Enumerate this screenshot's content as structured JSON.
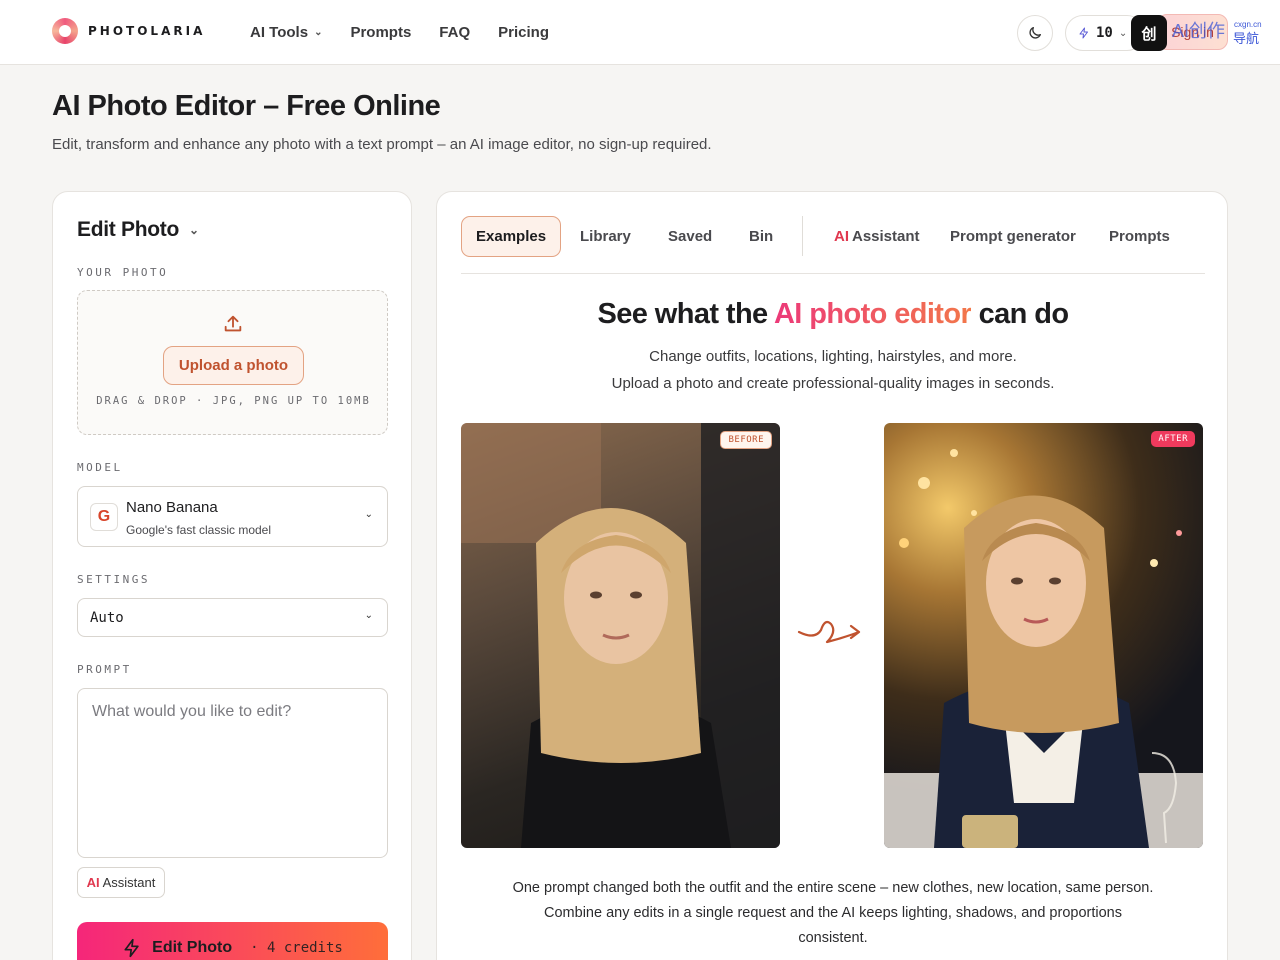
{
  "header": {
    "logo_text": "PHOTOLARIA",
    "nav": [
      {
        "label": "AI Tools",
        "has_dropdown": true
      },
      {
        "label": "Prompts"
      },
      {
        "label": "FAQ"
      },
      {
        "label": "Pricing"
      }
    ],
    "credits": "10",
    "signin_label": "Sign in",
    "overlay": {
      "badge": "创",
      "text": "AI创作",
      "sub": "cxgn.cn",
      "sub2": "导航"
    }
  },
  "page": {
    "title": "AI Photo Editor – Free Online",
    "subtitle": "Edit, transform and enhance any photo with a text prompt – an AI image editor, no sign-up required."
  },
  "editor": {
    "title": "Edit Photo",
    "photo_label": "YOUR PHOTO",
    "upload_button": "Upload a photo",
    "upload_hint": "DRAG & DROP · JPG, PNG UP TO 10MB",
    "model_label": "MODEL",
    "model_name": "Nano Banana",
    "model_desc": "Google's fast classic model",
    "model_logo": "G",
    "settings_label": "SETTINGS",
    "settings_value": "Auto",
    "prompt_label": "PROMPT",
    "prompt_placeholder": "What would you like to edit?",
    "assistant_ai": "AI",
    "assistant_label": "Assistant",
    "edit_button": "Edit Photo",
    "edit_credits": "· 4 credits"
  },
  "showcase": {
    "tabs": [
      {
        "label": "Examples",
        "active": true
      },
      {
        "label": "Library"
      },
      {
        "label": "Saved"
      },
      {
        "label": "Bin"
      },
      {
        "ai": "AI",
        "label": "Assistant"
      },
      {
        "label": "Prompt generator"
      },
      {
        "label": "Prompts"
      }
    ],
    "title_pre": "See what the ",
    "title_highlight": "AI photo editor",
    "title_post": " can do",
    "sub_line1": "Change outfits, locations, lighting, hairstyles, and more.",
    "sub_line2": "Upload a photo and create professional-quality images in seconds.",
    "before_tag": "BEFORE",
    "after_tag": "AFTER",
    "caption_line1": "One prompt changed both the outfit and the entire scene – new clothes, new location, same person.",
    "caption_line2": "Combine any edits in a single request and the AI keeps lighting, shadows, and proportions",
    "caption_line3": "consistent."
  },
  "colors": {
    "accent_orange": "#c0532f",
    "gradient_start": "#f5267a",
    "gradient_end": "#ff6e3a",
    "ai_red": "#e0384f"
  }
}
